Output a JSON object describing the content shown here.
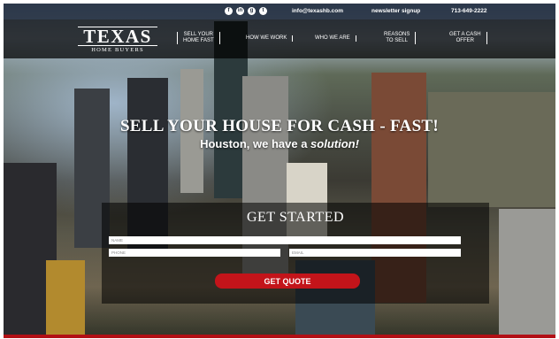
{
  "topbar": {
    "social_icons": [
      "facebook-icon",
      "linkedin-icon",
      "google-icon",
      "twitter-icon"
    ],
    "social_glyphs": [
      "f",
      "in",
      "g",
      "t"
    ],
    "email": "info@texashb.com",
    "newsletter": "newsletter signup",
    "phone": "713-649-2222"
  },
  "logo": {
    "main": "TEXAS",
    "sub": "HOME BUYERS"
  },
  "nav": {
    "items": [
      {
        "line1": "SELL YOUR",
        "line2": "HOME FAST"
      },
      {
        "line1": "HOW WE WORK",
        "line2": ""
      },
      {
        "line1": "WHO WE ARE",
        "line2": ""
      },
      {
        "line1": "REASONS",
        "line2": "TO SELL"
      },
      {
        "line1": "GET A CASH",
        "line2": "OFFER"
      }
    ]
  },
  "hero": {
    "headline": "SELL YOUR HOUSE FOR CASH - FAST!",
    "sub_prefix": "Houston, we have a ",
    "sub_emphasis": "solution!"
  },
  "form": {
    "title": "GET STARTED",
    "name_placeholder": "NAME",
    "phone_placeholder": "PHONE",
    "email_placeholder": "EMAIL",
    "submit_label": "GET QUOTE"
  },
  "colors": {
    "accent": "#c3141a",
    "nav_bg": "#000000"
  }
}
